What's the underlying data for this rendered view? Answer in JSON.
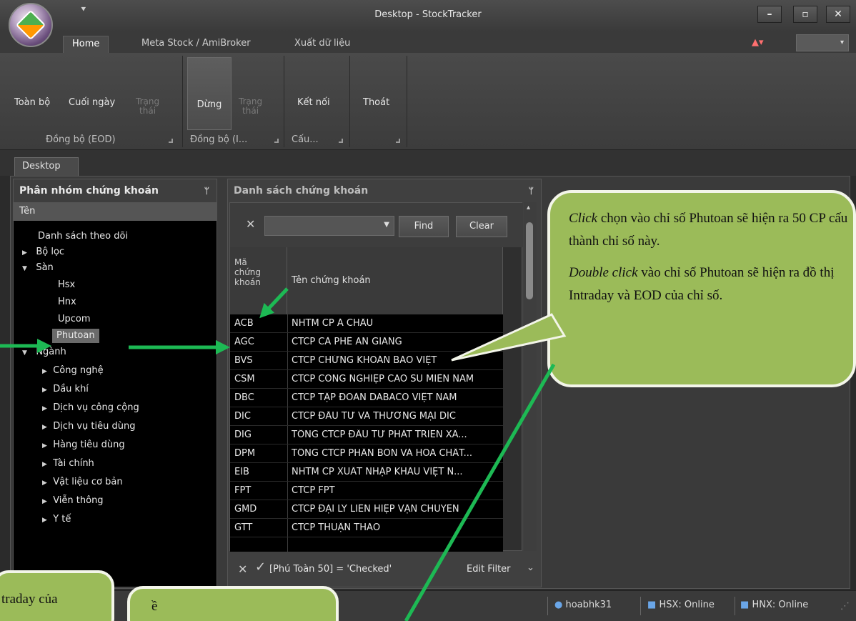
{
  "window": {
    "title": "Desktop - StockTracker",
    "qat": "⯆",
    "min": "–",
    "max": "▫",
    "close": "✕"
  },
  "tabs": {
    "home": "Home",
    "meta": "Meta Stock / AmiBroker",
    "export": "Xuất dữ liệu",
    "chart_icon": "▲▾",
    "combo_arrow": "▾"
  },
  "ribbon": {
    "all": "Toàn bộ",
    "end_of_day": "Cuối ngày",
    "status1_line1": "Trạng",
    "status1_line2": "thái",
    "stop": "Dừng",
    "status2_line1": "Trạng",
    "status2_line2": "thái",
    "connect": "Kết nối",
    "exit": "Thoát",
    "group_eod": "Đồng bộ (EOD)",
    "group_intraday": "Đồng bộ (I...",
    "group_config": "Cấu..."
  },
  "doc_tab": "Desktop",
  "left_panel": {
    "title": "Phân nhóm chứng khoán",
    "pin": "ᛘ",
    "column": "Tên",
    "items": {
      "watchlist": "Danh sách theo dõi",
      "filter": "Bộ lọc",
      "exchange": "Sàn",
      "hsx": "Hsx",
      "hnx": "Hnx",
      "upcom": "Upcom",
      "phutoan": "Phutoan",
      "sector": "Ngành",
      "tech": "Công nghệ",
      "oil": "Dầu khí",
      "utilities": "Dịch vụ công cộng",
      "consumer_services": "Dịch vụ tiêu dùng",
      "consumer_goods": "Hàng tiêu dùng",
      "finance": "Tài chính",
      "materials": "Vật liệu cơ bản",
      "telecom": "Viễn thông",
      "health": "Y tế"
    }
  },
  "mid_panel": {
    "title": "Danh sách chứng khoán",
    "pin": "ᛘ",
    "clear_x": "✕",
    "find": "Find",
    "clear": "Clear",
    "col_code_1": "Mã",
    "col_code_2": "chứng",
    "col_code_3": "khoán",
    "col_name": "Tên chứng khoán",
    "rows": [
      {
        "code": "ACB",
        "name": "NHTM CP Á CHÂU"
      },
      {
        "code": "AGC",
        "name": "CTCP CÀ PHÊ AN GIANG"
      },
      {
        "code": "BVS",
        "name": "CTCP CHỨNG KHOÁN BẢO VIỆT"
      },
      {
        "code": "CSM",
        "name": "CTCP CÔNG NGHIỆP CAO SU MIỀN NAM"
      },
      {
        "code": "DBC",
        "name": "CTCP TẬP ĐOÀN DABACO VIỆT NAM"
      },
      {
        "code": "DIC",
        "name": "CTCP ĐẦU TƯ VÀ THƯƠNG MẠI DIC"
      },
      {
        "code": "DIG",
        "name": "TỔNG CTCP ĐẦU TƯ PHÁT TRIỂN XÂ..."
      },
      {
        "code": "DPM",
        "name": "TỔNG CTCP PHÂN BÓN VÀ HÓA CHẤT..."
      },
      {
        "code": "EIB",
        "name": "NHTM CP XUẤT NHẬP KHẨU VIỆT N..."
      },
      {
        "code": "FPT",
        "name": "CTCP FPT"
      },
      {
        "code": "GMD",
        "name": "CTCP ĐẠI LÝ LIÊN HIỆP VẬN CHUYỂN"
      },
      {
        "code": "GTT",
        "name": "CTCP THUẬN THẢO"
      }
    ],
    "filter_text": "[Phú Toàn 50] = 'Checked'",
    "filter_check": "✓",
    "edit_filter": "Edit Filter",
    "scroll_up": "▴",
    "edit_arrow": "⌄"
  },
  "status": {
    "user": "hoabhk31",
    "hsx": "HSX: Online",
    "hnx": "HNX: Online"
  },
  "annotations": {
    "click_word": "Click",
    "click_text": " chọn  vào chỉ số Phutoan sẽ hiện ra 50 CP cấu thành chỉ số này.",
    "dbl_word": "Double click",
    "dbl_text": " vào chỉ số Phutoan sẽ hiện ra đồ thị Intraday và EOD của chỉ số.",
    "lower_left": "traday của",
    "lower_mid": "ề"
  },
  "colors": {
    "callout": "#9bbb59",
    "arrow": "#1db954"
  }
}
